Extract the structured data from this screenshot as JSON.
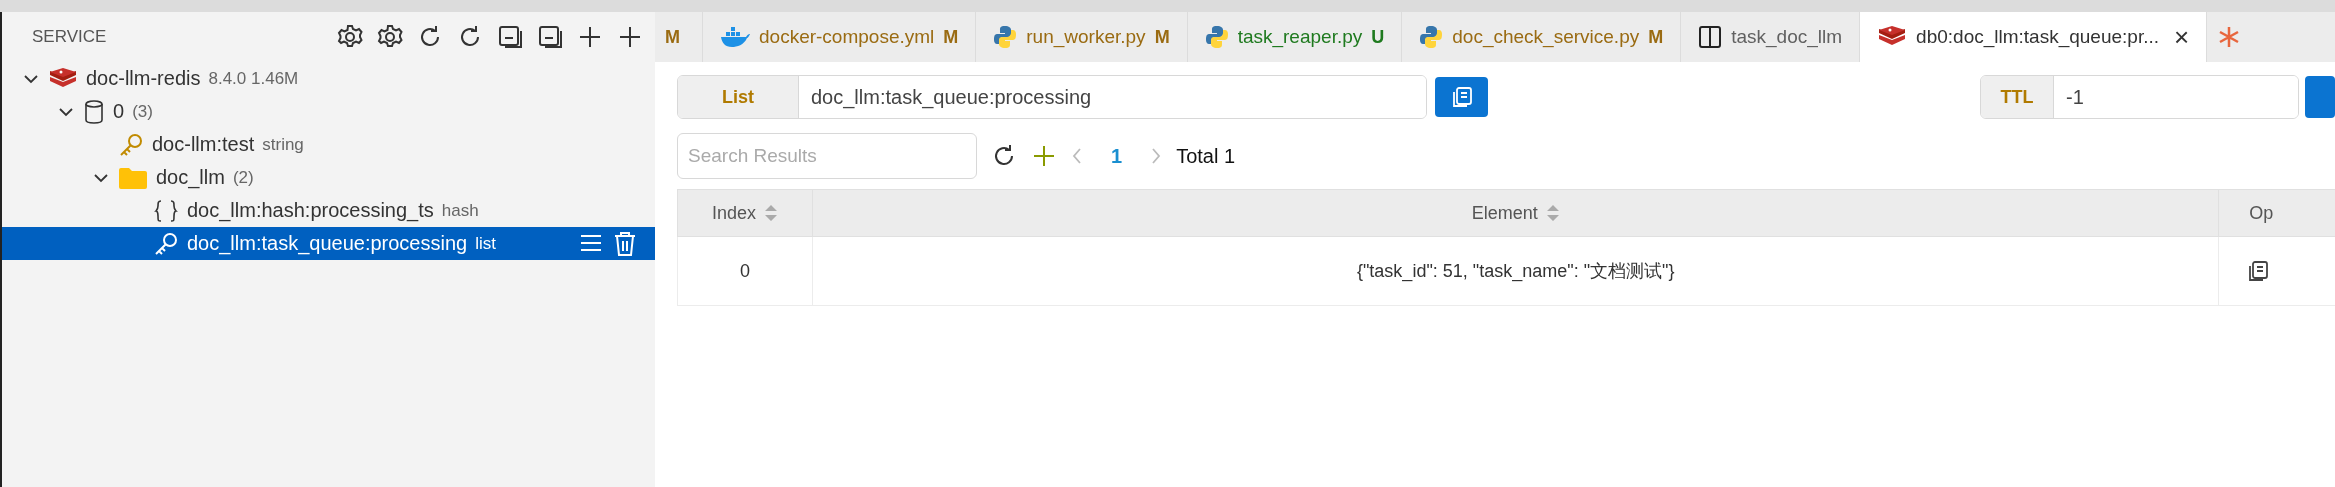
{
  "sidebar": {
    "title": "SERVICE",
    "tree": [
      {
        "kind": "connection",
        "label": "doc-llm-redis",
        "meta": "8.4.0 1.46M",
        "expanded": true,
        "selected": false,
        "children": [
          {
            "kind": "db",
            "label": "0",
            "meta": "(3)",
            "expanded": true,
            "selected": false,
            "children": [
              {
                "kind": "key",
                "label": "doc-llm:test",
                "meta": "string",
                "selected": false
              },
              {
                "kind": "folder",
                "label": "doc_llm",
                "meta": "(2)",
                "expanded": true,
                "selected": false,
                "children": [
                  {
                    "kind": "hash",
                    "label": "doc_llm:hash:processing_ts",
                    "meta": "hash",
                    "selected": false
                  },
                  {
                    "kind": "key",
                    "label": "doc_llm:task_queue:processing",
                    "meta": "list",
                    "selected": true
                  }
                ]
              }
            ]
          }
        ]
      }
    ]
  },
  "tabs": [
    {
      "kind": "none",
      "status": "M",
      "color": "#9a6b12",
      "selected": false
    },
    {
      "kind": "docker",
      "label": "docker-compose.yml",
      "status": "M",
      "color": "#9a6b12",
      "selected": false
    },
    {
      "kind": "python",
      "label": "run_worker.py",
      "status": "M",
      "color": "#9a6b12",
      "selected": false
    },
    {
      "kind": "python",
      "label": "task_reaper.py",
      "status": "U",
      "color": "#1f7a1f",
      "selected": false
    },
    {
      "kind": "python",
      "label": "doc_check_service.py",
      "status": "M",
      "color": "#9a6b12",
      "selected": false
    },
    {
      "kind": "layout",
      "label": "task_doc_llm",
      "color": "#616161",
      "selected": false
    },
    {
      "kind": "redis",
      "label": "db0:doc_llm:task_queue:pr...",
      "color": "#333333",
      "selected": true,
      "close": "×"
    }
  ],
  "key": {
    "type": "List",
    "name": "doc_llm:task_queue:processing",
    "ttl_label": "TTL",
    "ttl": "-1"
  },
  "search": {
    "placeholder": "Search Results"
  },
  "pager": {
    "page": "1",
    "total": "Total 1"
  },
  "table": {
    "columns": [
      "Index",
      "Element",
      "Op"
    ],
    "rows": [
      {
        "index": "0",
        "element": "{\"task_id\": 51, \"task_name\": \"文档测试\"}"
      }
    ]
  }
}
